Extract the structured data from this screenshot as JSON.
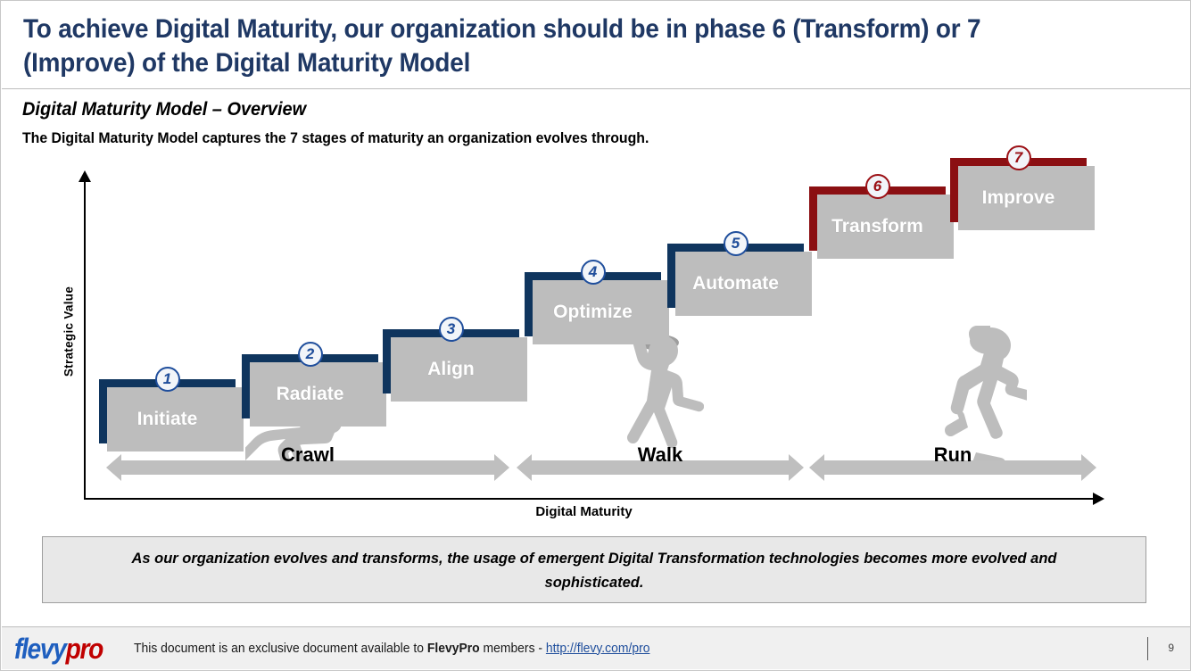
{
  "header": {
    "title": "To achieve Digital Maturity, our organization should be in phase 6 (Transform) or 7 (Improve) of the Digital Maturity Model"
  },
  "body": {
    "subtitle": "Digital Maturity Model – Overview",
    "lead": "The Digital Maturity Model captures the 7 stages of maturity an organization evolves through."
  },
  "chart_data": {
    "type": "bar",
    "title": "Digital Maturity Model – Overview",
    "xlabel": "Digital Maturity",
    "ylabel": "Strategic Value",
    "grid": false,
    "legend": "none",
    "categories": [
      "Initiate",
      "Radiate",
      "Align",
      "Optimize",
      "Automate",
      "Transform",
      "Improve"
    ],
    "values": [
      1,
      2,
      3,
      4,
      5,
      6,
      7
    ],
    "stages": [
      {
        "number": "1",
        "label": "Initiate",
        "color": "#0F355E",
        "phase": "Crawl"
      },
      {
        "number": "2",
        "label": "Radiate",
        "color": "#0F355E",
        "phase": "Crawl"
      },
      {
        "number": "3",
        "label": "Align",
        "color": "#0F355E",
        "phase": "Crawl"
      },
      {
        "number": "4",
        "label": "Optimize",
        "color": "#0F355E",
        "phase": "Walk"
      },
      {
        "number": "5",
        "label": "Automate",
        "color": "#0F355E",
        "phase": "Walk"
      },
      {
        "number": "6",
        "label": "Transform",
        "color": "#8B0F12",
        "phase": "Run"
      },
      {
        "number": "7",
        "label": "Improve",
        "color": "#8B0F12",
        "phase": "Run"
      }
    ],
    "phases": [
      {
        "label": "Crawl",
        "icon": "crawling-baby-silhouette"
      },
      {
        "label": "Walk",
        "icon": "walking-person-silhouette"
      },
      {
        "label": "Run",
        "icon": "running-person-silhouette"
      }
    ],
    "axis_colors": {
      "blue": "#0F355E",
      "red": "#8B0F12",
      "arrow_gray": "#bfbfbf"
    }
  },
  "callout": {
    "text": "As our organization evolves and transforms, the usage of emergent Digital Transformation technologies becomes more evolved and sophisticated."
  },
  "footer": {
    "logo_part1": "flevy",
    "logo_part2": "pro",
    "text_before": "This document is an exclusive document available to ",
    "brand": "FlevyPro",
    "text_after": " members - ",
    "link": "http://flevy.com/pro",
    "page_number": "9"
  }
}
